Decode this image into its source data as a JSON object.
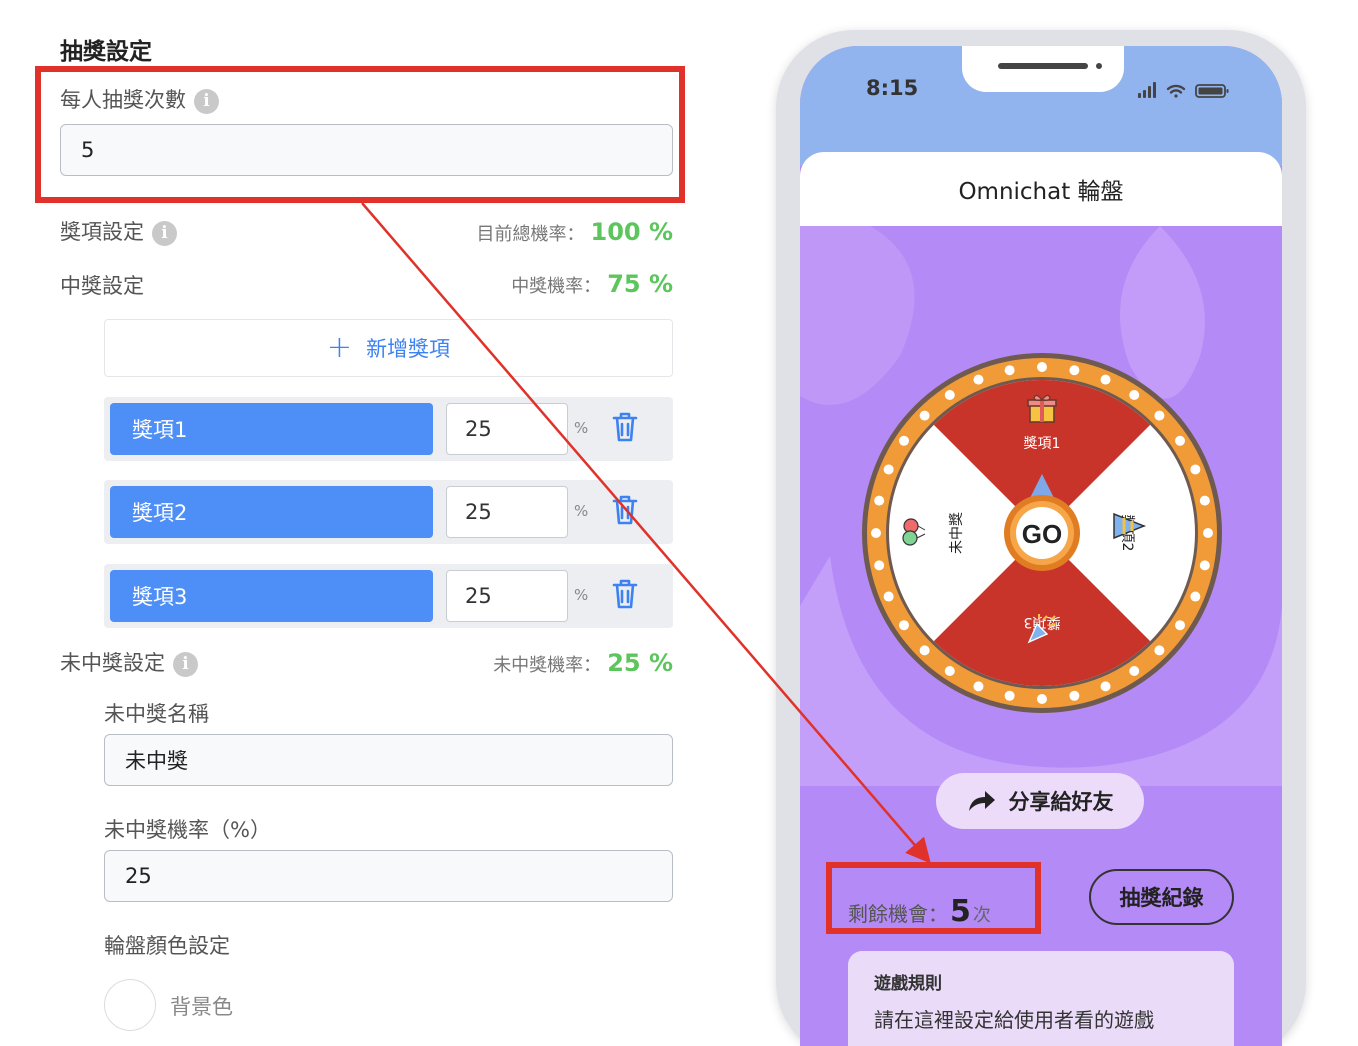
{
  "settings": {
    "title": "抽獎設定",
    "draws_label": "每人抽獎次數",
    "draws_value": "5",
    "prize_settings_label": "獎項設定",
    "total_rate_label": "目前總機率：",
    "total_rate_value": "100 %",
    "win_settings_label": "中獎設定",
    "win_rate_label": "中獎機率：",
    "win_rate_value": "75 %",
    "add_prize_label": "新增獎項",
    "prizes": [
      {
        "name": "獎項1",
        "value": "25"
      },
      {
        "name": "獎項2",
        "value": "25"
      },
      {
        "name": "獎項3",
        "value": "25"
      }
    ],
    "percent_sign": "%",
    "lose_settings_label": "未中獎設定",
    "lose_rate_label": "未中獎機率：",
    "lose_rate_value": "25 %",
    "lose_name_label": "未中獎名稱",
    "lose_name_value": "未中獎",
    "lose_prob_label": "未中獎機率（%）",
    "lose_prob_value": "25",
    "wheel_color_label": "輪盤顏色設定",
    "bg_color_label": "背景色"
  },
  "phone": {
    "time": "8:15",
    "app_title": "Omnichat 輪盤",
    "wheel": {
      "go_label": "GO",
      "segments": [
        "獎項1",
        "獎項2",
        "獎項3",
        "未中獎"
      ],
      "colors": {
        "red": "#c9342a",
        "white": "#ffffff",
        "rim": "#f19a38",
        "rim_edge": "#6f5a4f"
      }
    },
    "share_label": "分享給好友",
    "remaining_label": "剩餘機會：",
    "remaining_value": "5",
    "remaining_unit": "次",
    "record_label": "抽獎紀錄",
    "rules_title": "遊戲規則",
    "rules_text": "請在這裡設定給使用者看的遊戲"
  },
  "colors": {
    "accent_blue": "#4e8ef7",
    "rate_green": "#5cc55c",
    "highlight_red": "#e0322a",
    "phone_purple": "#b48af6"
  }
}
